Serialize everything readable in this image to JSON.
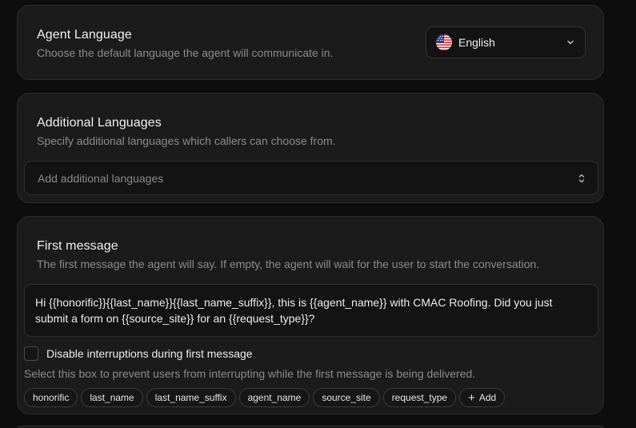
{
  "agent_language": {
    "title": "Agent Language",
    "description": "Choose the default language the agent will communicate in.",
    "selected": "English",
    "flag_icon": "us-flag-icon"
  },
  "additional_languages": {
    "title": "Additional Languages",
    "description": "Specify additional languages which callers can choose from.",
    "placeholder": "Add additional languages"
  },
  "first_message": {
    "title": "First message",
    "description": "The first message the agent will say. If empty, the agent will wait for the user to start the conversation.",
    "value": "Hi {{honorific}}{{last_name}}{{last_name_suffix}}, this is {{agent_name}} with CMAC Roofing. Did you just submit a form on {{source_site}} for an {{request_type}}?",
    "disable_interruptions_label": "Disable interruptions during first message",
    "disable_interruptions_checked": false,
    "disable_interruptions_help": "Select this box to prevent users from interrupting while the first message is being delivered.",
    "variables": [
      "honorific",
      "last_name",
      "last_name_suffix",
      "agent_name",
      "source_site",
      "request_type"
    ],
    "add_label": "Add"
  },
  "colors": {
    "background": "#0d0d0d",
    "card": "#1b1b1b",
    "border": "#2c2c2c",
    "muted_text": "#8b8b8b"
  }
}
